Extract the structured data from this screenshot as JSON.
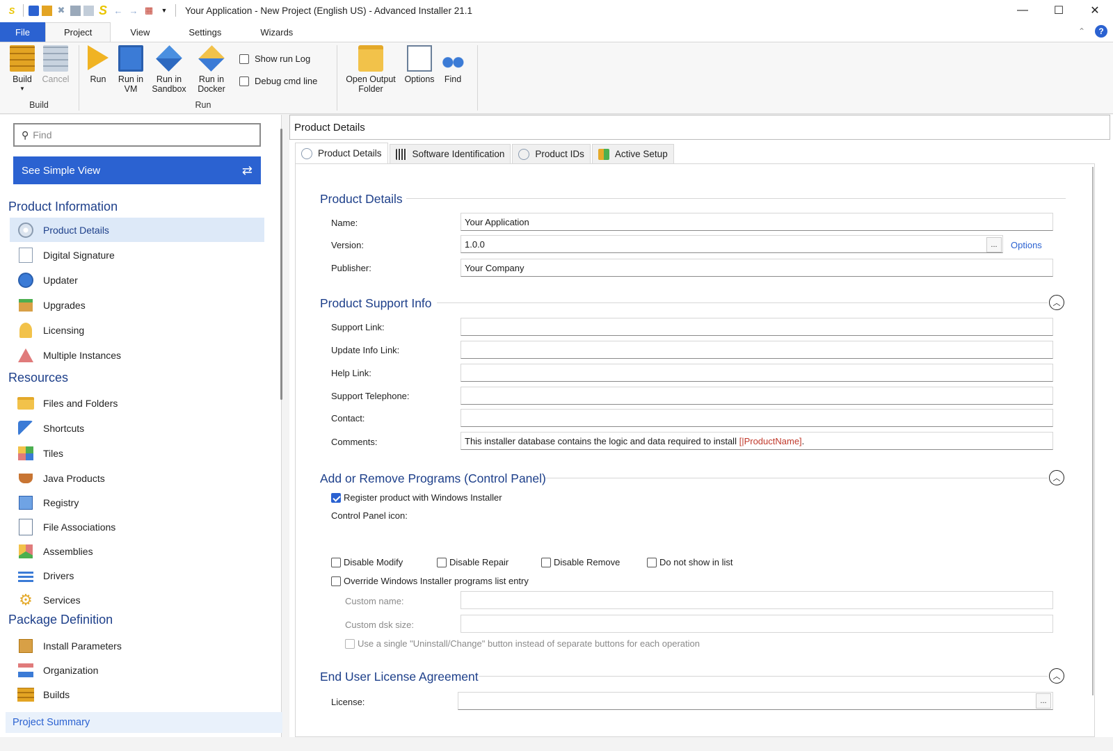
{
  "window": {
    "title": "Your Application - New Project (English US) - Advanced Installer 21.1"
  },
  "ribbon_tabs": [
    {
      "label": "File"
    },
    {
      "label": "Project"
    },
    {
      "label": "View"
    },
    {
      "label": "Settings"
    },
    {
      "label": "Wizards"
    }
  ],
  "ribbon": {
    "build_label": "Build",
    "cancel_label": "Cancel",
    "run_label": "Run",
    "run_vm_label": "Run in VM",
    "run_sandbox_label": "Run in Sandbox",
    "run_docker_label": "Run in Docker",
    "show_log_label": "Show run Log",
    "debug_cmd_label": "Debug cmd line",
    "open_output_label": "Open Output Folder",
    "options_label": "Options",
    "find_label": "Find",
    "group_build": "Build",
    "group_run": "Run"
  },
  "sidebar": {
    "search_placeholder": "Find",
    "simple_view_label": "See Simple View",
    "sections": [
      {
        "title": "Product Information"
      },
      {
        "title": "Resources"
      },
      {
        "title": "Package Definition"
      }
    ],
    "items": [
      {
        "label": "Product Details",
        "icon": "disc-icon"
      },
      {
        "label": "Digital Signature",
        "icon": "signature-icon"
      },
      {
        "label": "Updater",
        "icon": "globe-icon"
      },
      {
        "label": "Upgrades",
        "icon": "upgrade-box-icon"
      },
      {
        "label": "Licensing",
        "icon": "key-icon"
      },
      {
        "label": "Multiple Instances",
        "icon": "network-icon"
      },
      {
        "label": "Files and Folders",
        "icon": "folder-icon"
      },
      {
        "label": "Shortcuts",
        "icon": "arrow-shortcut-icon"
      },
      {
        "label": "Tiles",
        "icon": "tiles-icon"
      },
      {
        "label": "Java Products",
        "icon": "java-cup-icon"
      },
      {
        "label": "Registry",
        "icon": "registry-cubes-icon"
      },
      {
        "label": "File Associations",
        "icon": "file-assoc-icon"
      },
      {
        "label": "Assemblies",
        "icon": "assembly-cubes-icon"
      },
      {
        "label": "Drivers",
        "icon": "drivers-icon"
      },
      {
        "label": "Services",
        "icon": "gears-icon"
      },
      {
        "label": "Install Parameters",
        "icon": "install-box-icon"
      },
      {
        "label": "Organization",
        "icon": "org-tree-icon"
      },
      {
        "label": "Builds",
        "icon": "bricks-icon"
      }
    ],
    "project_summary_label": "Project Summary"
  },
  "main": {
    "header_title": "Product Details",
    "tabs": [
      {
        "label": "Product Details"
      },
      {
        "label": "Software Identification"
      },
      {
        "label": "Product IDs"
      },
      {
        "label": "Active Setup"
      }
    ],
    "section_product_details": "Product Details",
    "name_label": "Name:",
    "name_value": "Your Application",
    "version_label": "Version:",
    "version_value": "1.0.0",
    "version_button": "...",
    "options_link": "Options",
    "publisher_label": "Publisher:",
    "publisher_value": "Your Company",
    "section_support": "Product Support Info",
    "support_link_label": "Support Link:",
    "update_info_label": "Update Info Link:",
    "help_link_label": "Help Link:",
    "support_tel_label": "Support Telephone:",
    "contact_label": "Contact:",
    "comments_label": "Comments:",
    "comments_prefix": "This installer database contains the logic and data required to install ",
    "comments_token": "[|ProductName]",
    "comments_suffix": ".",
    "section_arp": "Add or Remove Programs (Control Panel)",
    "register_label": "Register product with Windows Installer",
    "cp_icon_label": "Control Panel icon:",
    "disable_modify": "Disable Modify",
    "disable_repair": "Disable Repair",
    "disable_remove": "Disable Remove",
    "not_show": "Do not show in list",
    "override_label": "Override Windows Installer programs list entry",
    "custom_name_label": "Custom name:",
    "custom_disk_label": "Custom dsk size:",
    "single_button_label": "Use a single \"Uninstall/Change\" button instead of separate buttons for each operation",
    "section_eula": "End User License Agreement",
    "license_label": "License:",
    "license_button": "..."
  }
}
